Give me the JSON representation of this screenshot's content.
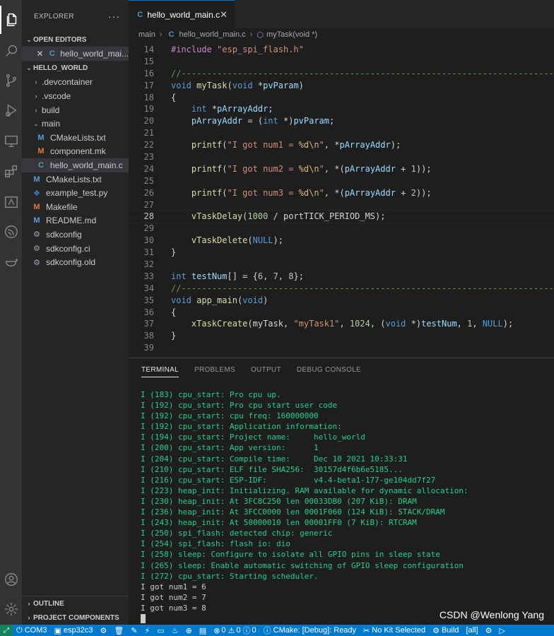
{
  "explorer": {
    "title": "EXPLORER",
    "more": "···",
    "open_editors_title": "OPEN EDITORS",
    "open_editor_file": "hello_world_mai...",
    "workspace_title": "HELLO_WORLD",
    "tree": [
      {
        "label": ".devcontainer",
        "kind": "folder"
      },
      {
        "label": ".vscode",
        "kind": "folder"
      },
      {
        "label": "build",
        "kind": "folder"
      },
      {
        "label": "main",
        "kind": "folder-open"
      },
      {
        "label": "CMakeLists.txt",
        "kind": "cmake"
      },
      {
        "label": "component.mk",
        "kind": "make"
      },
      {
        "label": "hello_world_main.c",
        "kind": "c"
      },
      {
        "label": "CMakeLists.txt",
        "kind": "cmake"
      },
      {
        "label": "example_test.py",
        "kind": "py"
      },
      {
        "label": "Makefile",
        "kind": "make"
      },
      {
        "label": "README.md",
        "kind": "md"
      },
      {
        "label": "sdkconfig",
        "kind": "gear"
      },
      {
        "label": "sdkconfig.ci",
        "kind": "gear"
      },
      {
        "label": "sdkconfig.old",
        "kind": "gear"
      }
    ],
    "outline_title": "OUTLINE",
    "project_components_title": "PROJECT COMPONENTS"
  },
  "editor": {
    "tab_label": "hello_world_main.c",
    "breadcrumb": [
      "main",
      "hello_world_main.c",
      "myTask(void *)"
    ],
    "current_line": 28,
    "lines": [
      {
        "n": 14,
        "text": "#include \"esp_spi_flash.h\""
      },
      {
        "n": 15,
        "text": ""
      },
      {
        "n": 16,
        "text": "//--------------------------------------------------------------------------------"
      },
      {
        "n": 17,
        "text": "void myTask(void *pvParam)"
      },
      {
        "n": 18,
        "text": "{"
      },
      {
        "n": 19,
        "text": "    int *pArrayAddr;"
      },
      {
        "n": 20,
        "text": "    pArrayAddr = (int *)pvParam;"
      },
      {
        "n": 21,
        "text": ""
      },
      {
        "n": 22,
        "text": "    printf(\"I got num1 = %d\\n\", *pArrayAddr);"
      },
      {
        "n": 23,
        "text": ""
      },
      {
        "n": 24,
        "text": "    printf(\"I got num2 = %d\\n\", *(pArrayAddr + 1));"
      },
      {
        "n": 25,
        "text": ""
      },
      {
        "n": 26,
        "text": "    printf(\"I got num3 = %d\\n\", *(pArrayAddr + 2));"
      },
      {
        "n": 27,
        "text": ""
      },
      {
        "n": 28,
        "text": "    vTaskDelay(1000 / portTICK_PERIOD_MS);"
      },
      {
        "n": 29,
        "text": ""
      },
      {
        "n": 30,
        "text": "    vTaskDelete(NULL);"
      },
      {
        "n": 31,
        "text": "}"
      },
      {
        "n": 32,
        "text": ""
      },
      {
        "n": 33,
        "text": "int testNum[] = {6, 7, 8};"
      },
      {
        "n": 34,
        "text": "//--------------------------------------------------------------------------------"
      },
      {
        "n": 35,
        "text": "void app_main(void)"
      },
      {
        "n": 36,
        "text": "{"
      },
      {
        "n": 37,
        "text": "    xTaskCreate(myTask, \"myTask1\", 1024, (void *)testNum, 1, NULL);"
      },
      {
        "n": 38,
        "text": "}"
      },
      {
        "n": 39,
        "text": ""
      }
    ]
  },
  "panel": {
    "tabs": [
      "TERMINAL",
      "PROBLEMS",
      "OUTPUT",
      "DEBUG CONSOLE"
    ],
    "active_tab": "TERMINAL",
    "terminal_lines": [
      {
        "text": "I (183) cpu_start: Pro cpu up.",
        "kind": "log"
      },
      {
        "text": "I (192) cpu_start: Pro cpu start user code",
        "kind": "log"
      },
      {
        "text": "I (192) cpu_start: cpu freq: 160000000",
        "kind": "log"
      },
      {
        "text": "I (192) cpu_start: Application information:",
        "kind": "log"
      },
      {
        "text": "I (194) cpu_start: Project name:     hello_world",
        "kind": "log"
      },
      {
        "text": "I (200) cpu_start: App version:      1",
        "kind": "log"
      },
      {
        "text": "I (204) cpu_start: Compile time:     Dec 10 2021 10:33:31",
        "kind": "log"
      },
      {
        "text": "I (210) cpu_start: ELF file SHA256:  30157d4f6b6e5185...",
        "kind": "log"
      },
      {
        "text": "I (216) cpu_start: ESP-IDF:          v4.4-beta1-177-ge104dd7f27",
        "kind": "log"
      },
      {
        "text": "I (223) heap_init: Initializing. RAM available for dynamic allocation:",
        "kind": "log"
      },
      {
        "text": "I (230) heap_init: At 3FC8C250 len 00033DB0 (207 KiB): DRAM",
        "kind": "log"
      },
      {
        "text": "I (236) heap_init: At 3FCC0000 len 0001F060 (124 KiB): STACK/DRAM",
        "kind": "log"
      },
      {
        "text": "I (243) heap_init: At 50000010 len 00001FF0 (7 KiB): RTCRAM",
        "kind": "log"
      },
      {
        "text": "I (250) spi_flash: detected chip: generic",
        "kind": "log"
      },
      {
        "text": "I (254) spi_flash: flash io: dio",
        "kind": "log"
      },
      {
        "text": "I (258) sleep: Configure to isolate all GPIO pins in sleep state",
        "kind": "log"
      },
      {
        "text": "I (265) sleep: Enable automatic switching of GPIO sleep configuration",
        "kind": "log"
      },
      {
        "text": "I (272) cpu_start: Starting scheduler.",
        "kind": "log"
      },
      {
        "text": "I got num1 = 6",
        "kind": "out"
      },
      {
        "text": "I got num2 = 7",
        "kind": "out"
      },
      {
        "text": "I got num3 = 8",
        "kind": "out"
      }
    ],
    "watermark": "CSDN @Wenlong Yang"
  },
  "statusbar": {
    "port": "COM3",
    "target": "esp32c3",
    "problems_errors": "0",
    "problems_warnings": "0",
    "problems_info": "0",
    "cmake": "CMake: [Debug]: Ready",
    "kit": "No Kit Selected",
    "build": "Build",
    "build_target": "[all]",
    "accent": "#007acc"
  }
}
